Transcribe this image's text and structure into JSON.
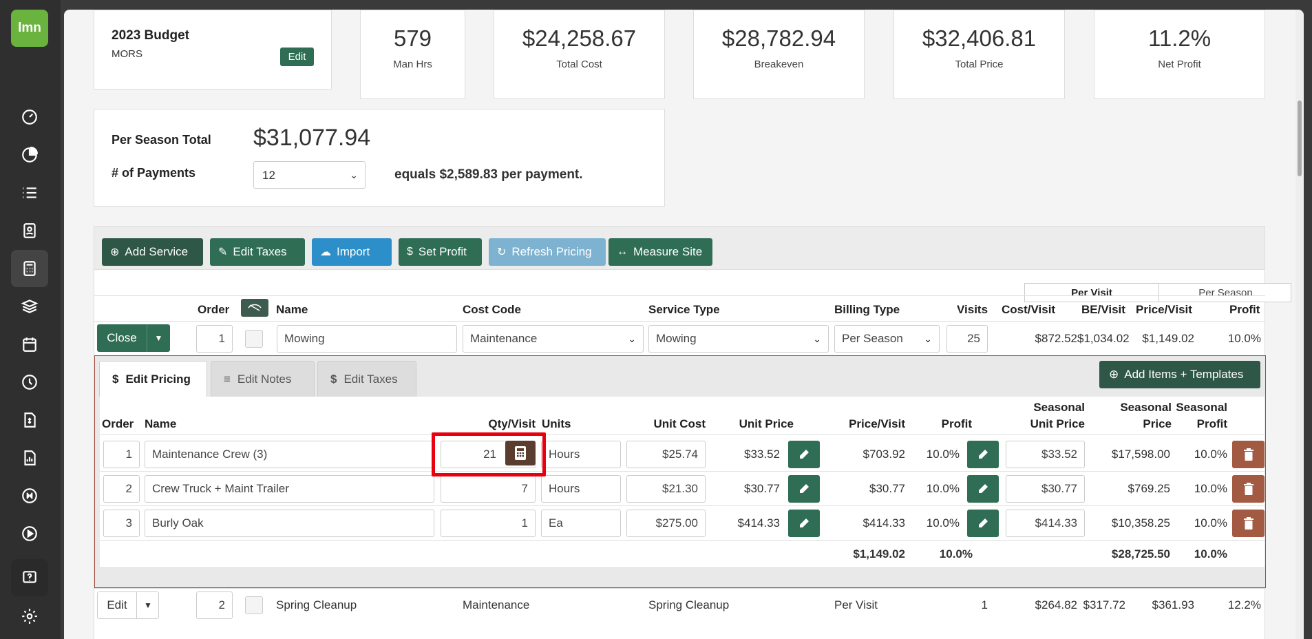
{
  "sidebar": {
    "logo": "lmn",
    "items": [
      "dashboard-icon",
      "pie-chart-icon",
      "list-icon",
      "contacts-icon",
      "calculator-icon",
      "layers-icon",
      "calendar-icon",
      "clock-icon",
      "invoice-icon",
      "report-icon",
      "qb-icon",
      "play-icon",
      "help-icon",
      "settings-icon"
    ],
    "active": "calculator-icon"
  },
  "budget": {
    "title": "2023 Budget",
    "subtitle": "MORS",
    "edit_label": "Edit"
  },
  "stats": [
    {
      "value": "579",
      "label": "Man Hrs"
    },
    {
      "value": "$24,258.67",
      "label": "Total Cost"
    },
    {
      "value": "$28,782.94",
      "label": "Breakeven"
    },
    {
      "value": "$32,406.81",
      "label": "Total Price"
    },
    {
      "value": "11.2%",
      "label": "Net Profit"
    }
  ],
  "season": {
    "total_label": "Per Season Total",
    "total_value": "$31,077.94",
    "payments_label": "# of Payments",
    "payments_value": "12",
    "equals_text": "equals $2,589.83 per payment."
  },
  "toolbar": {
    "add_service": "Add Service",
    "edit_taxes": "Edit Taxes",
    "import": "Import",
    "set_profit": "Set Profit",
    "refresh_pricing": "Refresh Pricing",
    "measure_site": "Measure Site"
  },
  "view_toggle": {
    "per_visit": "Per Visit",
    "per_season": "Per Season"
  },
  "services_header": [
    "Order",
    "Name",
    "Cost Code",
    "Service Type",
    "Billing Type",
    "Visits",
    "Cost/Visit",
    "BE/Visit",
    "Price/Visit",
    "Profit"
  ],
  "service_1": {
    "close_label": "Close",
    "order": "1",
    "name": "Mowing",
    "cost_code": "Maintenance",
    "service_type": "Mowing",
    "billing_type": "Per Season",
    "visits": "25",
    "cost_visit": "$872.52",
    "be_visit": "$1,034.02",
    "price_visit": "$1,149.02",
    "profit": "10.0%"
  },
  "tabs": {
    "edit_pricing": "Edit Pricing",
    "edit_notes": "Edit Notes",
    "edit_taxes": "Edit Taxes"
  },
  "add_items_label": "Add Items + Templates",
  "items_header": {
    "order": "Order",
    "name": "Name",
    "qty": "Qty/Visit",
    "units": "Units",
    "unit_cost": "Unit Cost",
    "unit_price": "Unit Price",
    "price_visit": "Price/Visit",
    "profit": "Profit",
    "seasonal_unit_price_1": "Seasonal",
    "seasonal_unit_price_2": "Unit Price",
    "seasonal_price_1": "Seasonal",
    "seasonal_price_2": "Price",
    "seasonal_profit_1": "Seasonal",
    "seasonal_profit_2": "Profit"
  },
  "items": [
    {
      "order": "1",
      "name": "Maintenance Crew (3)",
      "qty": "21",
      "units": "Hours",
      "unit_cost": "$25.74",
      "unit_price": "$33.52",
      "price_visit": "$703.92",
      "profit": "10.0%",
      "seasonal_unit_price": "$33.52",
      "seasonal_price": "$17,598.00",
      "seasonal_profit": "10.0%"
    },
    {
      "order": "2",
      "name": "Crew Truck + Maint Trailer",
      "qty": "7",
      "units": "Hours",
      "unit_cost": "$21.30",
      "unit_price": "$30.77",
      "price_visit": "$30.77",
      "profit": "10.0%",
      "seasonal_unit_price": "$30.77",
      "seasonal_price": "$769.25",
      "seasonal_profit": "10.0%"
    },
    {
      "order": "3",
      "name": "Burly Oak",
      "qty": "1",
      "units": "Ea",
      "unit_cost": "$275.00",
      "unit_price": "$414.33",
      "price_visit": "$414.33",
      "profit": "10.0%",
      "seasonal_unit_price": "$414.33",
      "seasonal_price": "$10,358.25",
      "seasonal_profit": "10.0%"
    }
  ],
  "items_totals": {
    "price_visit": "$1,149.02",
    "profit": "10.0%",
    "seasonal_price": "$28,725.50",
    "seasonal_profit": "10.0%"
  },
  "service_2": {
    "edit_label": "Edit",
    "order": "2",
    "name": "Spring Cleanup",
    "cost_code": "Maintenance",
    "service_type": "Spring Cleanup",
    "billing_type": "Per Visit",
    "visits": "1",
    "cost_visit": "$264.82",
    "be_visit": "$317.72",
    "price_visit": "$361.93",
    "profit": "12.2%"
  },
  "colors": {
    "primary_green": "#2f6e54",
    "dark_green": "#2f5748",
    "blue": "#2d8fc9",
    "light_blue": "#7db3d1",
    "brown": "#5a3d2e",
    "delete": "#a35a42",
    "highlight": "#e8000e",
    "logo": "#6bb33f"
  }
}
